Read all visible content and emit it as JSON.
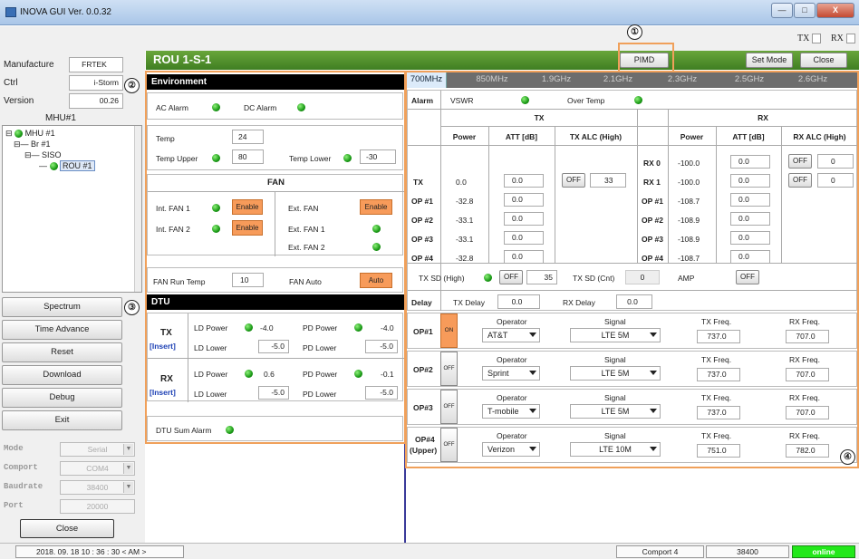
{
  "window": {
    "title": "INOVA GUI Ver. 0.0.32",
    "minimize": "—",
    "maximize": "□",
    "close": "X"
  },
  "toolbar": {
    "tx_label": "TX",
    "rx_label": "RX"
  },
  "left": {
    "manufacturer_label": "Manufacture",
    "manufacturer_value": "FRTEK",
    "ctrl_label": "Ctrl",
    "ctrl_value": "i-Storm",
    "version_label": "Version",
    "version_value": "00.26",
    "mhu_title": "MHU#1",
    "tree": {
      "n1": "MHU #1",
      "n2": "Br #1",
      "n3": "SISO",
      "n4": "ROU #1"
    },
    "buttons": [
      "Spectrum",
      "Time Advance",
      "Reset",
      "Download",
      "Debug",
      "Exit"
    ],
    "mode_label": "Mode",
    "mode_value": "Serial",
    "comport_label": "Comport",
    "comport_value": "COM4",
    "baud_label": "Baudrate",
    "baud_value": "38400",
    "port_label": "Port",
    "port_value": "20000",
    "close_label": "Close"
  },
  "rou": {
    "title": "ROU 1-S-1",
    "pimd": "PIMD",
    "setmode": "Set Mode",
    "close": "Close"
  },
  "annotations": {
    "a1": "①",
    "a2": "②",
    "a3": "③",
    "a4": "④"
  },
  "env": {
    "header": "Environment",
    "ac_alarm": "AC Alarm",
    "dc_alarm": "DC Alarm",
    "temp_label": "Temp",
    "temp_value": "24",
    "temp_upper_label": "Temp Upper",
    "temp_upper_value": "80",
    "temp_lower_label": "Temp Lower",
    "temp_lower_value": "-30",
    "fan_header": "FAN",
    "int_fan1": "Int. FAN 1",
    "int_fan2": "Int. FAN 2",
    "enable": "Enable",
    "ext_fan": "Ext. FAN",
    "ext_fan1": "Ext. FAN 1",
    "ext_fan2": "Ext. FAN 2",
    "fan_run_temp_label": "FAN Run Temp",
    "fan_run_temp_value": "10",
    "fan_auto_label": "FAN Auto",
    "fan_auto_value": "Auto"
  },
  "dtu": {
    "header": "DTU",
    "tx": "TX",
    "rx": "RX",
    "insert": "[Insert]",
    "ld_power": "LD Power",
    "pd_power": "PD Power",
    "ld_lower": "LD Lower",
    "pd_lower": "PD Lower",
    "tx_ld_power": "-4.0",
    "tx_pd_power": "-4.0",
    "tx_ld_lower": "-5.0",
    "tx_pd_lower": "-5.0",
    "rx_ld_power": "0.6",
    "rx_pd_power": "-0.1",
    "rx_ld_lower": "-5.0",
    "rx_pd_lower": "-5.0",
    "sum_alarm": "DTU Sum Alarm"
  },
  "tabs": [
    "700MHz",
    "850MHz",
    "1.9GHz",
    "2.1GHz",
    "2.3GHz",
    "2.5GHz",
    "2.6GHz"
  ],
  "rf": {
    "alarm": "Alarm",
    "vswr": "VSWR",
    "over_temp": "Over Temp",
    "tx_head": "TX",
    "rx_head": "RX",
    "power": "Power",
    "att": "ATT [dB]",
    "tx_alc": "TX ALC (High)",
    "rx_alc": "RX ALC (High)",
    "off": "OFF",
    "tx_alc_value": "33",
    "rx0_alc_value": "0",
    "rx1_alc_value": "0",
    "tx_rows": [
      {
        "label": "TX",
        "power": "0.0",
        "att": "0.0"
      },
      {
        "label": "OP #1",
        "power": "-32.8",
        "att": "0.0"
      },
      {
        "label": "OP #2",
        "power": "-33.1",
        "att": "0.0"
      },
      {
        "label": "OP #3",
        "power": "-33.1",
        "att": "0.0"
      },
      {
        "label": "OP #4",
        "power": "-32.8",
        "att": "0.0"
      }
    ],
    "rx_rows": [
      {
        "label": "RX 0",
        "power": "-100.0",
        "att": "0.0"
      },
      {
        "label": "RX 1",
        "power": "-100.0",
        "att": "0.0"
      },
      {
        "label": "OP #1",
        "power": "-108.7",
        "att": "0.0"
      },
      {
        "label": "OP #2",
        "power": "-108.9",
        "att": "0.0"
      },
      {
        "label": "OP #3",
        "power": "-108.9",
        "att": "0.0"
      },
      {
        "label": "OP #4",
        "power": "-108.7",
        "att": "0.0"
      }
    ],
    "tx_sd_high": "TX SD (High)",
    "tx_sd_value": "35",
    "tx_sd_cnt": "TX SD (Cnt)",
    "tx_sd_cnt_value": "0",
    "amp": "AMP",
    "amp_value": "OFF",
    "delay": "Delay",
    "tx_delay": "TX Delay",
    "tx_delay_value": "0.0",
    "rx_delay": "RX Delay",
    "rx_delay_value": "0.0"
  },
  "ops": {
    "operator_label": "Operator",
    "signal_label": "Signal",
    "txf_label": "TX Freq.",
    "rxf_label": "RX Freq.",
    "on": "ON",
    "off": "OFF",
    "rows": [
      {
        "label": "OP#1",
        "label2": "",
        "state": "ON",
        "operator": "AT&T",
        "signal": "LTE 5M",
        "tx": "737.0",
        "rx": "707.0"
      },
      {
        "label": "OP#2",
        "label2": "",
        "state": "OFF",
        "operator": "Sprint",
        "signal": "LTE 5M",
        "tx": "737.0",
        "rx": "707.0"
      },
      {
        "label": "OP#3",
        "label2": "",
        "state": "OFF",
        "operator": "T-mobile",
        "signal": "LTE 5M",
        "tx": "737.0",
        "rx": "707.0"
      },
      {
        "label": "OP#4",
        "label2": "(Upper)",
        "state": "OFF",
        "operator": "Verizon",
        "signal": "LTE 10M",
        "tx": "751.0",
        "rx": "782.0"
      }
    ]
  },
  "status": {
    "datetime": "2018. 09. 18   10 : 36 : 30 < AM >",
    "comport": "Comport 4",
    "baud": "38400",
    "online": "online"
  }
}
